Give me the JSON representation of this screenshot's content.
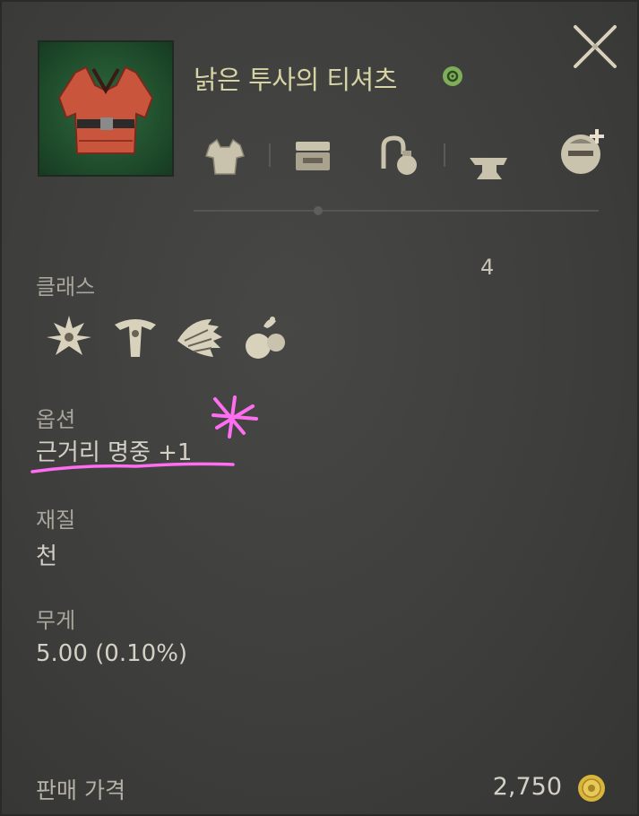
{
  "item": {
    "name": "낡은 투사의 티셔츠",
    "enhance_level": "4"
  },
  "icons": {
    "grade": "grade-badge-icon",
    "close": "close-x-icon",
    "equipment_type": "shirt-icon",
    "storage": "chest-icon",
    "trade": "trade-icon",
    "enhance": "anvil-icon",
    "add_friend": "character-add-icon",
    "coin": "gold-coin-icon"
  },
  "sections": {
    "class_label": "클래스",
    "classes": [
      "class-warrior-icon",
      "class-tamer-icon",
      "class-wing-icon",
      "class-pouch-icon"
    ],
    "option_label": "옵션",
    "option_value": "근거리 명중 +1",
    "material_label": "재질",
    "material_value": "천",
    "weight_label": "무게",
    "weight_value": "5.00 (0.10%)"
  },
  "footer": {
    "price_label": "판매 가격",
    "price_value": "2,750"
  },
  "colors": {
    "background": "#3e3e3c",
    "item_name": "#d6d3a4",
    "annotation": "#ff6ef0",
    "grade": "#7fae5a",
    "coin": "#d9b53a"
  }
}
